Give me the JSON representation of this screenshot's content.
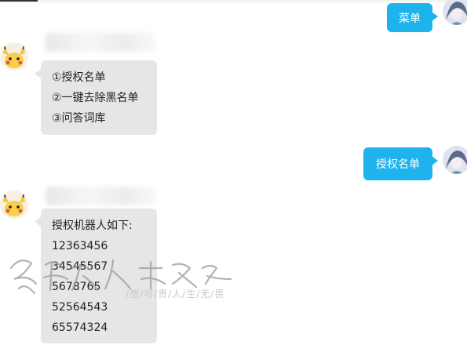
{
  "messages": {
    "out1": {
      "text": "菜单"
    },
    "in1": {
      "lines": [
        "①授权名单",
        "②一键去除黑名单",
        "③问答词库"
      ]
    },
    "out2": {
      "text": "授权名单"
    },
    "in2": {
      "lines": [
        "授权机器人如下:",
        "12363456",
        "34545567",
        "5678765",
        "52564543",
        "65574324"
      ]
    }
  },
  "watermark": {
    "subtitle": "/想/可/贵/人/生/无/畏"
  },
  "colors": {
    "outgoing_bubble": "#1fb3ee",
    "incoming_bubble": "#e6e6e6"
  },
  "icons": {
    "bot_avatar": "pikachu-avatar",
    "user_avatar": "anime-avatar"
  }
}
